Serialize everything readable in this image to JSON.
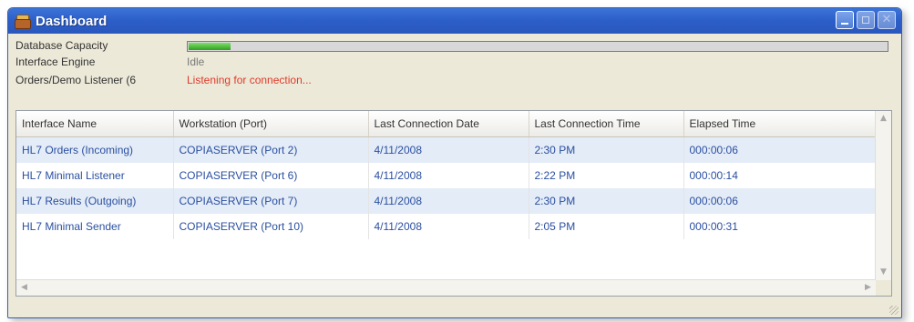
{
  "window": {
    "title": "Dashboard",
    "icon": "database-icon",
    "accent": "#2c5ec8"
  },
  "info": {
    "capacity_label": "Database Capacity",
    "capacity_fraction": 0.06,
    "engine_label": "Interface Engine",
    "engine_status": "Idle",
    "listener_label": "Orders/Demo Listener (6",
    "listener_status": "Listening for connection...",
    "listener_status_color": "#e03a2a"
  },
  "table": {
    "columns": [
      "Interface Name",
      "Workstation (Port)",
      "Last Connection Date",
      "Last Connection Time",
      "Elapsed Time"
    ],
    "rows": [
      [
        "HL7 Orders (Incoming)",
        "COPIASERVER (Port  2)",
        "4/11/2008",
        "2:30 PM",
        "000:00:06"
      ],
      [
        "HL7 Minimal Listener",
        "COPIASERVER (Port  6)",
        "4/11/2008",
        "2:22 PM",
        "000:00:14"
      ],
      [
        "HL7 Results (Outgoing)",
        "COPIASERVER (Port  7)",
        "4/11/2008",
        "2:30 PM",
        "000:00:06"
      ],
      [
        "HL7 Minimal Sender",
        "COPIASERVER (Port 10)",
        "4/11/2008",
        "2:05 PM",
        "000:00:31"
      ]
    ]
  }
}
